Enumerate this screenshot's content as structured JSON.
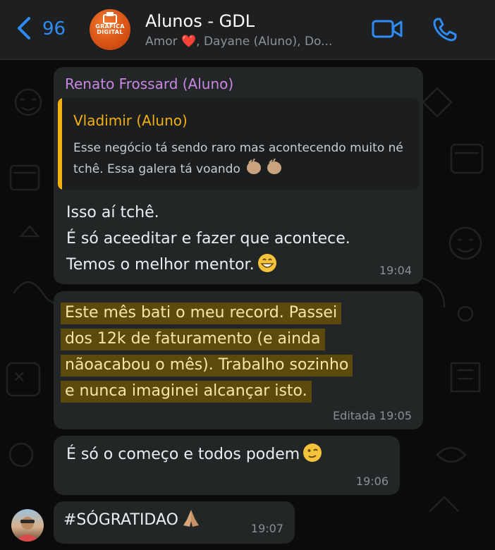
{
  "header": {
    "back_count": "96",
    "group_name": "Alunos - GDL",
    "avatar_text_1": "GRÁFICA",
    "avatar_text_2": "DIGITAL",
    "members_prefix": "Amor ",
    "members_heart": "❤️",
    "members_suffix": ", Dayane (Aluno), Do...",
    "icons": [
      "chevron-left-icon",
      "video-call-icon",
      "phone-icon"
    ],
    "accent_color": "#2f8cf5"
  },
  "messages": [
    {
      "sender": "Renato Frossard (Aluno)",
      "sender_color": "#c987e4",
      "quote": {
        "author": "Vladimir (Aluno)",
        "author_color": "#f2b00f",
        "text": "Esse negócio tá sendo raro mas acontecendo muito né tchê. Essa galera tá voando"
      },
      "lines": [
        "Isso aí tchê.",
        "É só aceeditar e fazer que acontece.",
        "Temos o melhor mentor."
      ],
      "time": "19:04"
    },
    {
      "lines": [
        "Este mês bati o meu record. Passei",
        "dos 12k de faturamento (e ainda",
        "nãoacabou o mês). Trabalho sozinho",
        "e nunca imaginei alcançar isto."
      ],
      "highlighted": true,
      "edited_label": "Editada",
      "time": "19:05"
    },
    {
      "text": "É só o começo e todos podem",
      "time": "19:06"
    },
    {
      "text": "#SÓGRATIDAO",
      "time": "19:07"
    }
  ]
}
